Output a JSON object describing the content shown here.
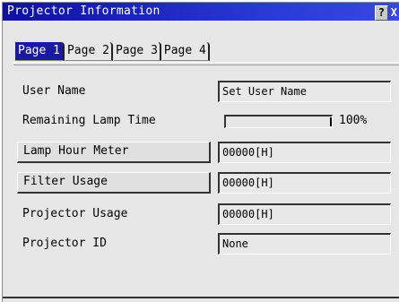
{
  "window": {
    "title": "Projector Information",
    "help_glyph": "?",
    "close_glyph": "X"
  },
  "tabs": [
    {
      "label": "Page 1",
      "active": true
    },
    {
      "label": "Page 2",
      "active": false
    },
    {
      "label": "Page 3",
      "active": false
    },
    {
      "label": "Page 4",
      "active": false
    }
  ],
  "rows": {
    "user_name": {
      "label": "User Name",
      "value": "Set User Name"
    },
    "remaining_lamp": {
      "label": "Remaining Lamp Time",
      "percent_text": "100%",
      "percent": 100
    },
    "lamp_hour": {
      "label": "Lamp Hour Meter",
      "value": "00000[H]"
    },
    "filter_usage": {
      "label": "Filter Usage",
      "value": "00000[H]"
    },
    "projector_usage": {
      "label": "Projector Usage",
      "value": "00000[H]"
    },
    "projector_id": {
      "label": "Projector ID",
      "value": "None"
    }
  }
}
